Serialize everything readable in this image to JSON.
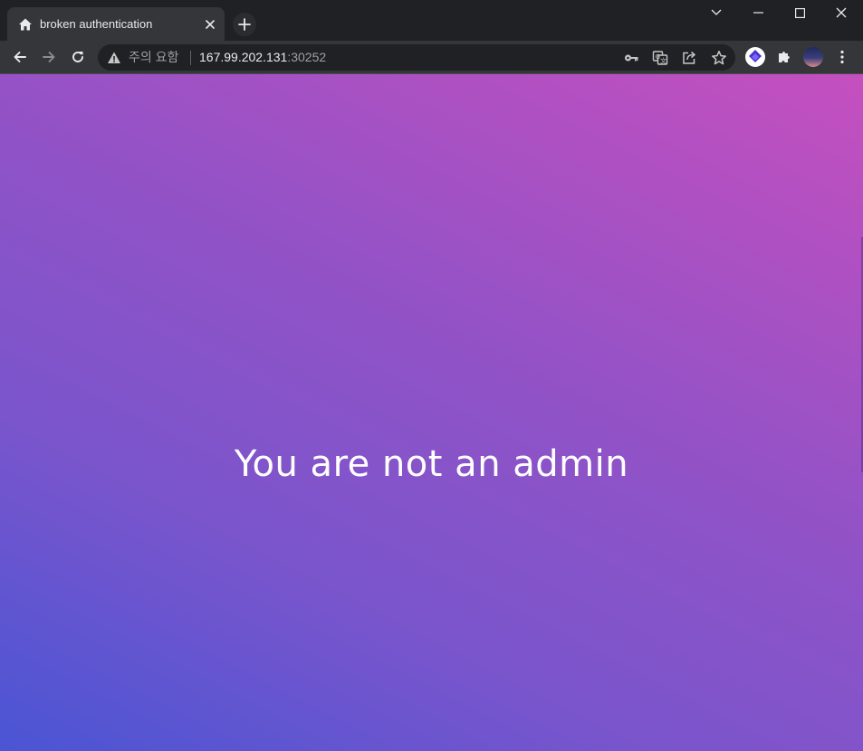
{
  "tab": {
    "title": "broken authentication",
    "favicon": "home-icon"
  },
  "toolbar": {
    "security_warning": "주의 요함",
    "url_host": "167.99.202.131",
    "url_port": ":30252"
  },
  "icons": {
    "back": "arrow-left-icon",
    "forward": "arrow-right-icon",
    "reload": "reload-icon",
    "warning": "warning-triangle-icon",
    "password": "key-icon",
    "translate": "translate-icon",
    "share": "share-icon",
    "bookmark": "star-icon",
    "extension": "puzzle-icon",
    "menu": "kebab-menu-icon"
  },
  "page": {
    "message": "You are not an admin"
  },
  "colors": {
    "gradient_start": "#4a55d4",
    "gradient_end": "#c54fbf",
    "text": "#ffffff",
    "chrome_dark": "#202124",
    "chrome_toolbar": "#35363a"
  }
}
